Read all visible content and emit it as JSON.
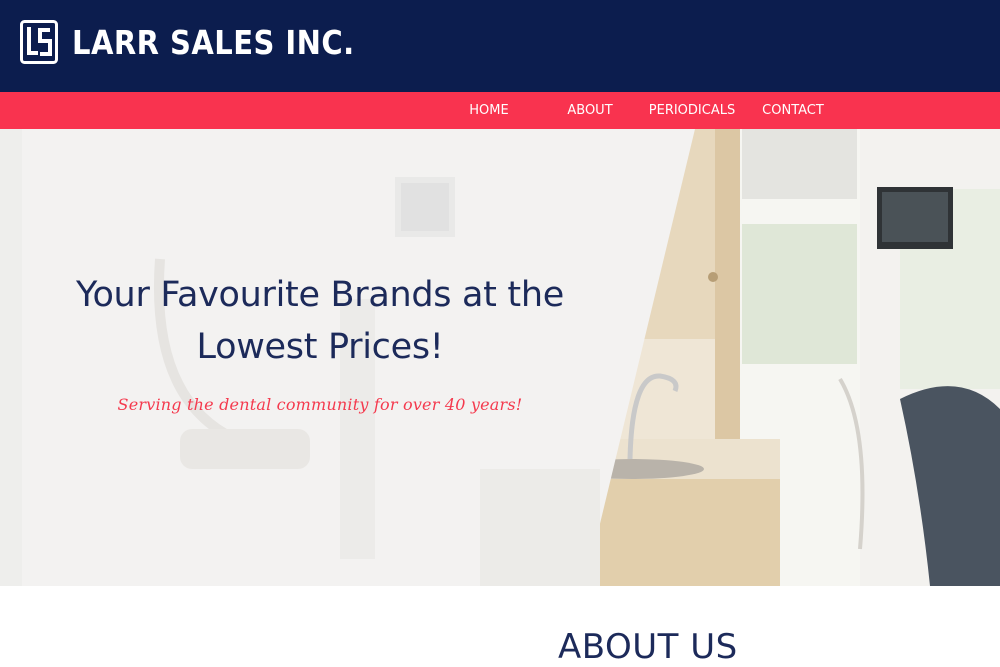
{
  "header": {
    "brand_name": "LARR SALES INC.",
    "logo_icon": "ls-monogram-logo",
    "background_color": "#0c1d4e"
  },
  "nav": {
    "background_color": "#f9334f",
    "items": [
      {
        "label": "HOME"
      },
      {
        "label": "ABOUT"
      },
      {
        "label": "PERIODICALS"
      },
      {
        "label": "CONTACT"
      }
    ]
  },
  "hero": {
    "headline_line1": "Your Favourite Brands at the",
    "headline_line2": "Lowest Prices!",
    "tagline": "Serving the dental community for over 40 years!",
    "image_subject": "dental-office-photo"
  },
  "about": {
    "title": "ABOUT US"
  }
}
